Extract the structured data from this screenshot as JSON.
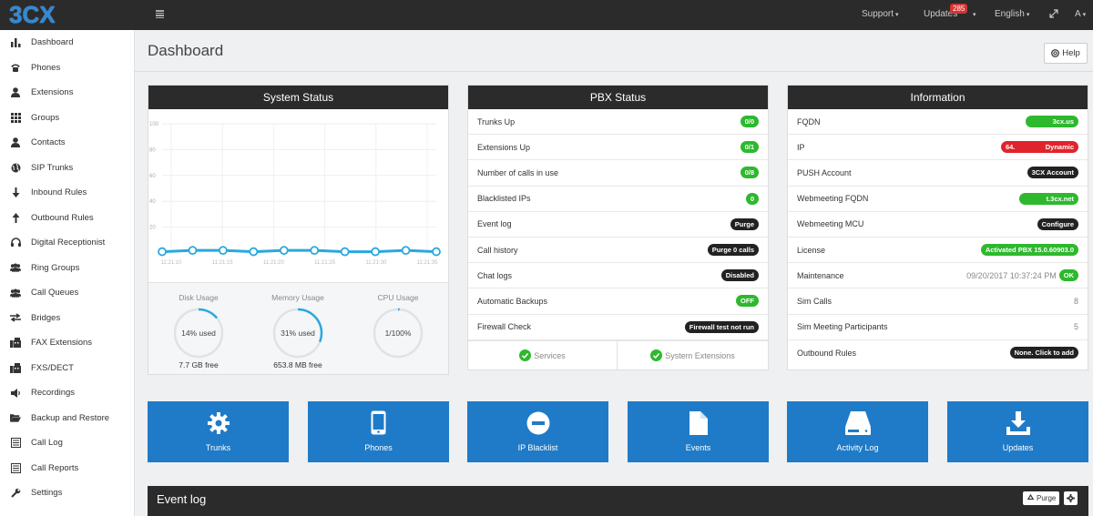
{
  "app": {
    "logo": "3CX"
  },
  "topbar": {
    "support": "Support",
    "updates": "Updates",
    "updates_count": "285",
    "language": "English",
    "user": "A"
  },
  "sidebar": {
    "items": [
      {
        "label": "Dashboard",
        "icon": "bar-chart-icon"
      },
      {
        "label": "Phones",
        "icon": "phone-icon"
      },
      {
        "label": "Extensions",
        "icon": "user-icon"
      },
      {
        "label": "Groups",
        "icon": "grid-icon"
      },
      {
        "label": "Contacts",
        "icon": "user-icon"
      },
      {
        "label": "SIP Trunks",
        "icon": "globe-icon"
      },
      {
        "label": "Inbound Rules",
        "icon": "arrow-down-icon"
      },
      {
        "label": "Outbound Rules",
        "icon": "arrow-up-icon"
      },
      {
        "label": "Digital Receptionist",
        "icon": "headset-icon"
      },
      {
        "label": "Ring Groups",
        "icon": "users-icon"
      },
      {
        "label": "Call Queues",
        "icon": "users-icon"
      },
      {
        "label": "Bridges",
        "icon": "exchange-icon"
      },
      {
        "label": "FAX Extensions",
        "icon": "fax-icon"
      },
      {
        "label": "FXS/DECT",
        "icon": "fax-icon"
      },
      {
        "label": "Recordings",
        "icon": "speaker-icon"
      },
      {
        "label": "Backup and Restore",
        "icon": "folder-icon"
      },
      {
        "label": "Call Log",
        "icon": "list-icon"
      },
      {
        "label": "Call Reports",
        "icon": "list-icon"
      },
      {
        "label": "Settings",
        "icon": "wrench-icon"
      }
    ]
  },
  "main": {
    "title": "Dashboard",
    "help": "Help"
  },
  "system_status": {
    "title": "System Status",
    "disk_label": "Disk Usage",
    "disk_value": "14% used",
    "disk_percent": 14,
    "disk_free": "7.7 GB free",
    "memory_label": "Memory Usage",
    "memory_value": "31% used",
    "memory_percent": 31,
    "memory_free": "653.8 MB free",
    "cpu_label": "CPU Usage",
    "cpu_value": "1/100%",
    "cpu_percent": 1
  },
  "chart_data": {
    "type": "line",
    "x": [
      "11:21:10",
      "11:21:15",
      "11:21:20",
      "11:21:25",
      "11:21:30",
      "11:21:35"
    ],
    "y_ticks": [
      100,
      80,
      60,
      40,
      20
    ],
    "ylim": [
      0,
      100
    ],
    "series": [
      {
        "values": [
          1,
          2,
          2,
          1,
          2,
          2,
          1,
          1,
          2,
          1
        ]
      }
    ],
    "line_color": "#29a8e0"
  },
  "pbx_status": {
    "title": "PBX Status",
    "rows": [
      {
        "label": "Trunks Up",
        "value": "0/0",
        "style": "green"
      },
      {
        "label": "Extensions Up",
        "value": "0/1",
        "style": "green"
      },
      {
        "label": "Number of calls in use",
        "value": "0/8",
        "style": "green"
      },
      {
        "label": "Blacklisted IPs",
        "value": "0",
        "style": "green"
      },
      {
        "label": "Event log",
        "value": "Purge",
        "style": "black"
      },
      {
        "label": "Call history",
        "value": "Purge 0 calls",
        "style": "black"
      },
      {
        "label": "Chat logs",
        "value": "Disabled",
        "style": "black"
      },
      {
        "label": "Automatic Backups",
        "value": "OFF",
        "style": "green"
      },
      {
        "label": "Firewall Check",
        "value": "Firewall test not run",
        "style": "black"
      }
    ],
    "services": "Services",
    "system_extensions": "System Extensions"
  },
  "information": {
    "title": "Information",
    "rows": [
      {
        "label": "FQDN",
        "value": "3cx.us",
        "style": "green"
      },
      {
        "label": "IP",
        "value": "64.                Dynamic",
        "style": "red"
      },
      {
        "label": "PUSH Account",
        "value": "3CX Account",
        "style": "black"
      },
      {
        "label": "Webmeeting FQDN",
        "value": "t.3cx.net",
        "style": "green"
      },
      {
        "label": "Webmeeting MCU",
        "value": "Configure",
        "style": "black"
      },
      {
        "label": "License",
        "value": "Activated PBX 15.0.60903.0",
        "style": "green"
      },
      {
        "label": "Maintenance",
        "value": "09/20/2017 10:37:24 PM",
        "badge": "OK",
        "style": "green"
      },
      {
        "label": "Sim Calls",
        "value": "8",
        "style": "plain"
      },
      {
        "label": "Sim Meeting Participants",
        "value": "5",
        "style": "plain"
      },
      {
        "label": "Outbound Rules",
        "value": "None. Click to add",
        "style": "black"
      }
    ]
  },
  "tiles": [
    {
      "label": "Trunks",
      "icon": "gear-icon"
    },
    {
      "label": "Phones",
      "icon": "mobile-icon"
    },
    {
      "label": "IP Blacklist",
      "icon": "minus-circle-icon"
    },
    {
      "label": "Events",
      "icon": "file-icon"
    },
    {
      "label": "Activity Log",
      "icon": "hdd-icon"
    },
    {
      "label": "Updates",
      "icon": "download-icon"
    }
  ],
  "event_log": {
    "title": "Event log",
    "purge": "Purge"
  },
  "colors": {
    "topbar": "#2b2b2b",
    "tile_blue": "#1f7bc7",
    "green": "#2eb82e",
    "red": "#e0242b"
  }
}
